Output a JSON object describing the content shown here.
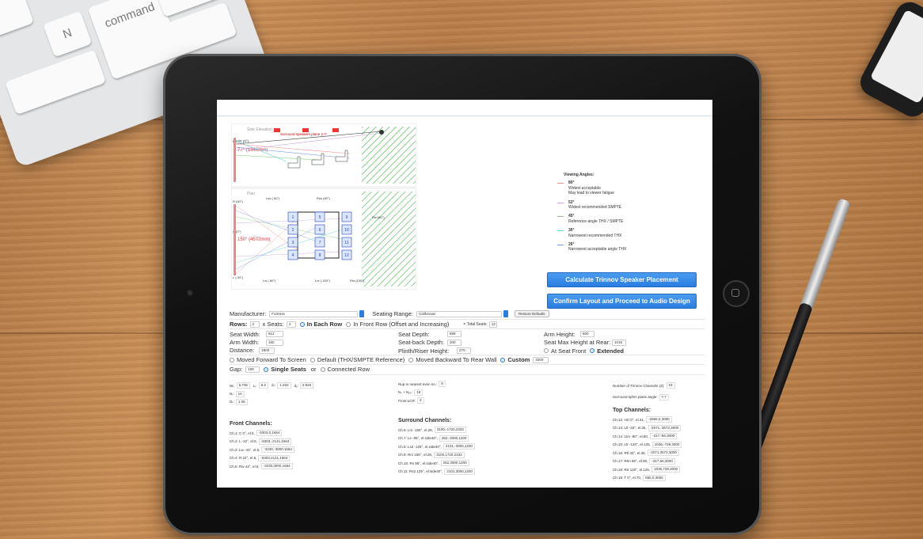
{
  "keyboard": {
    "keys": [
      "N",
      "command"
    ]
  },
  "legend": {
    "title": "Viewing Angles:",
    "items": [
      {
        "deg": "80°",
        "lines": [
          "Widest acceptable",
          "May lead to viewer fatigue"
        ],
        "color": "#f08a8a"
      },
      {
        "deg": "52°",
        "lines": [
          "Widest recommended SMPTE"
        ],
        "color": "#c7a0e0"
      },
      {
        "deg": "45°",
        "lines": [
          "Reference angle THX / SMPTE"
        ],
        "color": "#7fcf7f"
      },
      {
        "deg": "36°",
        "lines": [
          "Narrowest recommended THX"
        ],
        "color": "#5fd0d0"
      },
      {
        "deg": "26°",
        "lines": [
          "Narrowest acceptable angle THX"
        ],
        "color": "#7a9ae8"
      }
    ]
  },
  "buttons": {
    "calculate": "Calculate Trinnov Speaker Placement",
    "confirm": "Confirm Layout and Proceed to Audio Design",
    "restore": "Restore Defaults"
  },
  "diagram": {
    "side_label": "Side Elevation",
    "surround_label": "Surround speakers plane 2,7'",
    "lcr_label": "L/C/R (0°)",
    "angle_top": "77° (1946mm)",
    "plan_label": "Plan",
    "angle_plan": "150° (4572mm)",
    "l_label": "L (-30°)",
    "c_label": "C (0°)",
    "r_label": "R (30°)",
    "lw_label": "Lw (-60°)",
    "rw_label": "Rw (60°)",
    "lss_label": "Lss (-90°)",
    "rss_label": "Rss (90°)",
    "lrs_label": "Lrs (-150°)",
    "rrs_label": "Rrs (150°)",
    "seat_numbers": [
      "1",
      "2",
      "3",
      "4",
      "5",
      "6",
      "7",
      "8",
      "9",
      "10",
      "11",
      "12"
    ]
  },
  "form": {
    "manufacturer_label": "Manufacturer:",
    "manufacturer_value": "Fortress",
    "seating_range_label": "Seating Range:",
    "seating_range_value": "Californian",
    "rows_label": "Rows:",
    "rows_value": "3",
    "x_seats_label": "x Seats:",
    "seats_value": "4",
    "in_each_row": "In Each Row",
    "in_front_row": "In Front Row (Offset and Increasing)",
    "total_seats_label": "= Total Seats:",
    "total_seats_value": "12",
    "seat_width_label": "Seat Width:",
    "seat_width_value": "812",
    "arm_width_label": "Arm Width:",
    "arm_width_value": "160",
    "seat_depth_label": "Seat Depth:",
    "seat_depth_value": "889",
    "seatback_depth_label": "Seat-back Depth:",
    "seatback_depth_value": "200",
    "plinth_label": "Plinth/Riser Height:",
    "plinth_value": "270",
    "arm_height_label": "Arm Height:",
    "arm_height_value": "600",
    "seat_max_label": "Seat Max Height at Rear:",
    "seat_max_value": "1016",
    "at_seat_front": "At Seat Front",
    "extended": "Extended",
    "distance_label": "Distance:",
    "distance_value": "1800",
    "moved_forward": "Moved Forward To Screen",
    "default_ref": "Default (THX/SMPTE Reference)",
    "moved_backward": "Moved Backward To Rear Wall",
    "custom": "Custom",
    "custom_value": "3300",
    "gap_label": "Gap:",
    "gap_value": "100",
    "single_seats": "Single Seats",
    "or": "or",
    "connected_row": "Connected Row"
  },
  "dims": {
    "w_label": "Wᵣ:",
    "w_value": "5.736",
    "l_label": "Lᵣ:",
    "l_value": "6.2",
    "ds_label": "dₛ:",
    "ds_value": "1.632",
    "dy_label": "dᵧ:",
    "dy_value": "2.926",
    "nc_label": "Nᵣ:",
    "nc_value": "10",
    "dl_label": "Dₜ:",
    "dl_value": "1.05",
    "nup_label": "Nup to nearest even no.:",
    "nup_value": "8",
    "ns_label": "Nₛ + Nₒₚ:",
    "ns_value": "18",
    "front_lcr_label": "Front LCR:",
    "front_lcr_value": "3",
    "trinnov_label": "Number of Trinnov Channels (Z):",
    "trinnov_value": "19",
    "surround_angle_label": "Surround sphm plane angle:",
    "surround_angle_value": "7.7"
  },
  "front": {
    "title": "Front Channels:",
    "rows": [
      {
        "label": "Ch.1: C 0°, el.5,",
        "value": "-5303,0,1664"
      },
      {
        "label": "Ch.2: L -22°, el.5,",
        "value": "-5303,-2141,1664"
      },
      {
        "label": "Ch.3: Lw -43°, el.5,",
        "value": "-3230,-3000,1664"
      },
      {
        "label": "Ch.4: R 22°, el.5,",
        "value": "-5303,2141,1664"
      },
      {
        "label": "Ch.5: Rw 43°, el.5,",
        "value": "-3230,3000,1664"
      }
    ]
  },
  "surround": {
    "title": "Surround Channels:",
    "rows": [
      {
        "label": "Ch.6: Lrs -155°, el.28,",
        "value": "3100,-1720,2333"
      },
      {
        "label": "Ch.7: Ls -95°, el.side40°,",
        "value": "262,-3000,1200"
      },
      {
        "label": "Ch.8: Ls2 -125°, el.side40°,",
        "value": "2101,-3000,1200"
      },
      {
        "label": "Ch.9: Rrs 155°, el.28,",
        "value": "3100,1720,2333"
      },
      {
        "label": "Ch.10: Rs 95°, el.side40°,",
        "value": "262,3000,1200"
      },
      {
        "label": "Ch.11: Rs2 125°, el.side40°,",
        "value": "2101,3000,1200"
      }
    ]
  },
  "top": {
    "title": "Top Channels:",
    "rows": [
      {
        "label": "Ch.12: HC 0°, el.31,",
        "value": "-2866,0,3000"
      },
      {
        "label": "Ch.13: Ltf -33°, el.35,",
        "value": "-2071,-3672,3000"
      },
      {
        "label": "Ch.14: Ltm -80°, el.80,",
        "value": "-317,-56,3000"
      },
      {
        "label": "Ch.15: Ltr -120°, el.125,",
        "value": "1036,-728,3000"
      },
      {
        "label": "Ch.16: Rtf 33°, el.35,",
        "value": "-2071,3672,3000"
      },
      {
        "label": "Ch.17: Rtm 80°, el.80,",
        "value": "-317,56,3000"
      },
      {
        "label": "Ch.18: Rtr 120°, el.125,",
        "value": "1036,728,3000"
      },
      {
        "label": "Ch.19: T 0°, el.70,",
        "value": "655,0,3000"
      }
    ]
  }
}
